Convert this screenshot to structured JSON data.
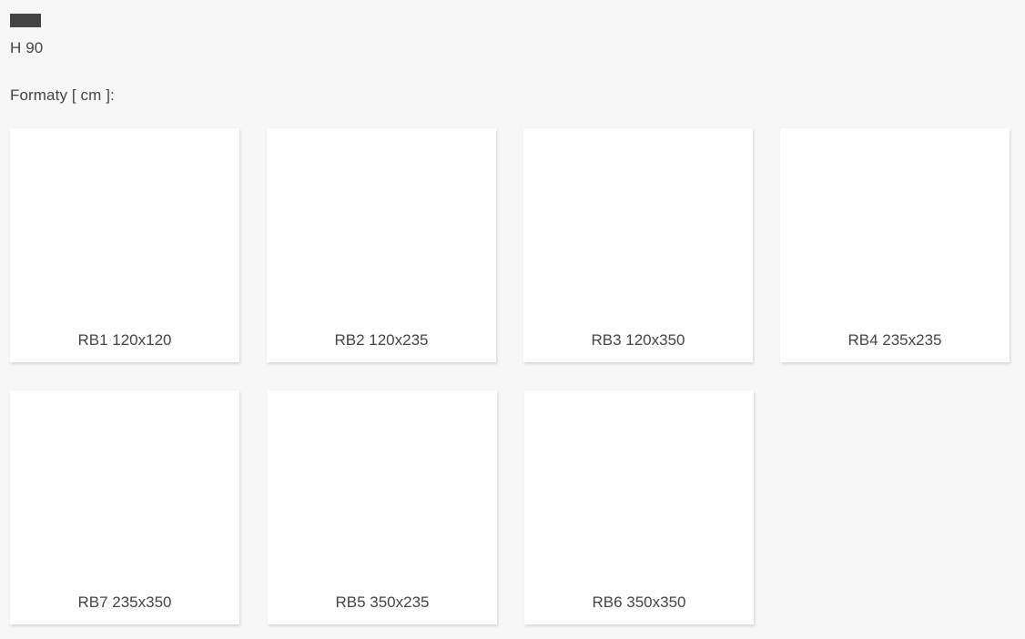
{
  "header": {
    "height": "H 90",
    "formats": "Formaty [ cm ]:"
  },
  "formats": [
    {
      "label": "RB1 120x120"
    },
    {
      "label": "RB2 120x235"
    },
    {
      "label": "RB3 120x350"
    },
    {
      "label": "RB4 235x235"
    },
    {
      "label": "RB7 235x350"
    },
    {
      "label": "RB5 350x235"
    },
    {
      "label": "RB6 350x350"
    }
  ],
  "colors": {
    "background": "#f7f7f7",
    "card": "#ffffff",
    "text": "#444444",
    "swatch": "#444444"
  }
}
